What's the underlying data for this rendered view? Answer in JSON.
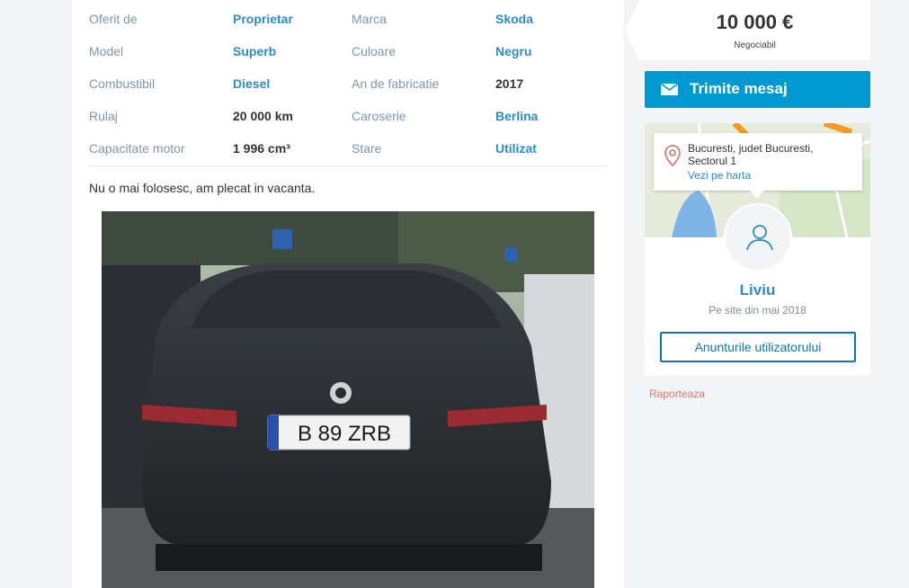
{
  "details": [
    {
      "label": "Oferit de",
      "value": "Proprietar",
      "label2": "Marca",
      "value2": "Skoda"
    },
    {
      "label": "Model",
      "value": "Superb",
      "label2": "Culoare",
      "value2": "Negru"
    },
    {
      "label": "Combustibil",
      "value": "Diesel",
      "label2": "An de fabricatie",
      "value2": "2017"
    },
    {
      "label": "Rulaj",
      "value": "20 000 km",
      "label2": "Caroserie",
      "value2": "Berlina"
    },
    {
      "label": "Capacitate motor",
      "value": "1 996 cm³",
      "label2": "Stare",
      "value2": "Utilizat"
    }
  ],
  "description": "Nu o mai folosesc, am plecat in vacanta.",
  "photo": {
    "plate": "B 89 ZRB"
  },
  "price": {
    "value": "10 000 €",
    "note": "Negociabil"
  },
  "actions": {
    "send_message": "Trimite mesaj",
    "user_ads": "Anunturile utilizatorului",
    "report": "Raporteaza"
  },
  "location": {
    "line1": "Bucuresti, judet Bucuresti,",
    "line2": "Sectorul 1",
    "map_link": "Vezi pe harta"
  },
  "seller": {
    "name": "Liviu",
    "since": "Pe site din mai 2018"
  },
  "icons": [
    "envelope-icon",
    "location-pin-icon",
    "user-icon"
  ],
  "colors": {
    "accent": "#0098d0",
    "link": "#2e8bc6",
    "report": "#d27a6a"
  }
}
